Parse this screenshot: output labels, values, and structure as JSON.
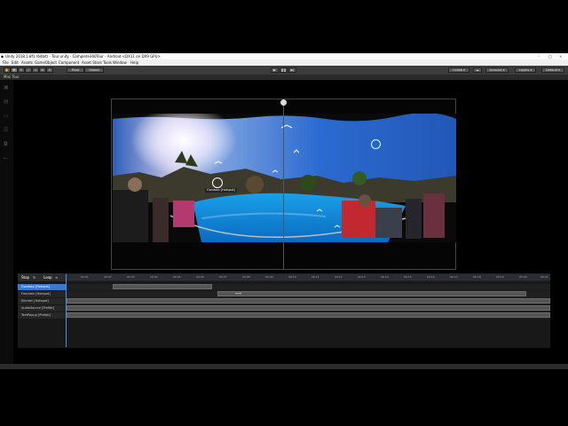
{
  "window": {
    "title": "Unity 2018.1.8f1 (64bit) - Tour.unity - Complete360Tour - Android <DX11 on DX9 GPU>",
    "controls": [
      "–",
      "□",
      "×"
    ]
  },
  "menu": [
    "File",
    "Edit",
    "Assets",
    "GameObject",
    "Component",
    "Asset Store Tools",
    "Window",
    "Help"
  ],
  "toolbar": {
    "pivot": "Pivot",
    "global": "Global",
    "collab": "Collab ▾",
    "account": "Account ▾",
    "layers": "Layers ▾",
    "layout": "Default ▾"
  },
  "scene_tab": {
    "label": "Mini Tour"
  },
  "viewport": {
    "hotspot_label": "Gondola [Hotspot]"
  },
  "timeline": {
    "controls": {
      "stop": "Stop",
      "loop": "Loop"
    },
    "ruler_ticks": [
      "00:01",
      "00:02",
      "00:03",
      "00:04",
      "00:05",
      "00:06",
      "00:07",
      "00:08",
      "00:09",
      "00:10",
      "00:11",
      "00:12",
      "00:13",
      "00:14",
      "00:15",
      "00:16",
      "00:17",
      "00:18",
      "00:19",
      "00:20",
      "00:21"
    ],
    "tracks": [
      {
        "label": "Gondola [Hotspot]",
        "selected": true
      },
      {
        "label": "Fountain [Hotspot]",
        "selected": false
      },
      {
        "label": "Kitchen [Hotspot]",
        "selected": false
      },
      {
        "label": "AudioSource [Prefab]",
        "selected": false
      },
      {
        "label": "TextPopup [Prefab]",
        "selected": false
      }
    ]
  },
  "colors": {
    "selection": "#3a78d4",
    "playhead": "#4b8de8",
    "background": "#000000"
  },
  "icons": [
    "unity-logo-icon",
    "hand-tool-icon",
    "move-tool-icon",
    "rotate-tool-icon",
    "scale-tool-icon",
    "rect-tool-icon",
    "transform-tool-icon",
    "play-icon",
    "pause-icon",
    "step-icon",
    "cloud-icon"
  ]
}
